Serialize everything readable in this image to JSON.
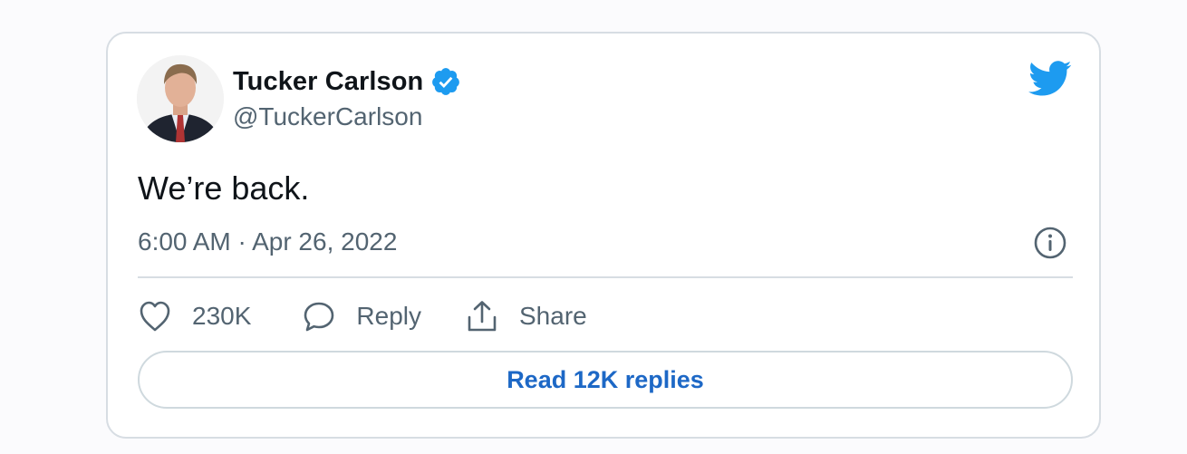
{
  "author": {
    "name": "Tucker Carlson",
    "handle": "@TuckerCarlson",
    "verified": true
  },
  "tweet": {
    "text": "We’re back.",
    "timestamp": "6:00 AM · Apr 26, 2022"
  },
  "actions": {
    "like_count": "230K",
    "reply_label": "Reply",
    "share_label": "Share"
  },
  "read_replies_label": "Read 12K replies",
  "colors": {
    "brand_blue": "#1d9bf0",
    "link_blue": "#1d68c6",
    "text_primary": "#0f1419",
    "text_secondary": "#536471",
    "border": "#d7dde3"
  },
  "icons": [
    "verified-badge-icon",
    "twitter-bird-icon",
    "info-icon",
    "heart-icon",
    "speech-bubble-icon",
    "share-icon"
  ]
}
